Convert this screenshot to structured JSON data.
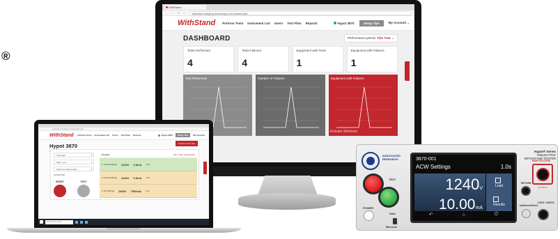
{
  "registered_mark": "®",
  "monitor": {
    "browser": {
      "tab_title": "WithStand",
      "nav_buttons": "← → C ⌂",
      "url": "withstand-staging.herokuapp.com/dashboard"
    },
    "app": {
      "logo_main": "WithStand",
      "logo_suffix": "",
      "menu": [
        "Perform Tests",
        "Instrument List",
        "Users",
        "Test Files",
        "Reports"
      ],
      "device_name": "Hypot 3870",
      "setup_button": "Setup Tips",
      "account": "My Account"
    },
    "dashboard": {
      "title": "DASHBOARD",
      "period_label": "Performance period:",
      "period_value": "This Year",
      "cards": [
        {
          "label": "Tests Performed",
          "value": "4"
        },
        {
          "label": "Tests Failures",
          "value": "4"
        },
        {
          "label": "Equipment with Tests",
          "value": "1"
        },
        {
          "label": "Equipment with Failures",
          "value": "1"
        }
      ],
      "charts": [
        {
          "title": "Test Performed"
        },
        {
          "title": "Number of Failures"
        },
        {
          "title": "Equipment with Failures"
        }
      ],
      "watermark": "Activate Windows"
    }
  },
  "laptop": {
    "url": "withstand-staging.herokuapp.com",
    "logo_main": "WithStand",
    "menu": [
      "Perform Tests",
      "Instrument List",
      "Users",
      "Test Files",
      "Reports"
    ],
    "device_name": "Hypot 3870",
    "setup_button": "Setup Tips",
    "account": "My Account",
    "title": "Hypot 3870",
    "subtitle": "Serial# 0002345 | Status: OUTPUT-ON",
    "red_button": "Perform Next Test",
    "selects": [
      "4 Product",
      "Step 1 of 1",
      "Select a serial number"
    ],
    "section_label": "ACCEPTED",
    "results": [
      {
        "label": "Product",
        "v1": "",
        "v2": "",
        "v3": "Fail - View Test Results"
      },
      {
        "label": "1. ACW Settings",
        "v1": "1240V",
        "v2": "0.5mA",
        "v3": "1.0s"
      },
      {
        "label": "2. ACW Settings",
        "v1": "1240V",
        "v2": "0.5mA",
        "v3": "1.0s"
      },
      {
        "label": "3. IR Settings",
        "v1": "1500V",
        "v2": "7500mA",
        "v3": "1.0s"
      }
    ],
    "buttons": {
      "reset": "RESET",
      "test": "TEST"
    },
    "search_placeholder": "Type here to search"
  },
  "device": {
    "brand": "ASSOCIATED RESEARCH",
    "series": "Hypot® Series",
    "series_sub": "DIELECTRIC WITHSTAND TESTER",
    "model": "3870-001",
    "mode": "ACW Settings",
    "time": "1.0s",
    "voltage": "1240",
    "voltage_unit": "V",
    "current": "10.00",
    "current_unit": "mA",
    "side_buttons": [
      "Load",
      "Results"
    ],
    "labels": {
      "test": "TEST",
      "power": "POWER",
      "data": "Data",
      "barcode": "Barcode",
      "hv": "HIGH VOLTAGE",
      "return": "RETURN",
      "caution": "CAUTION",
      "knob": "Up/Down/Select",
      "cont": "CONT. CHECK"
    }
  }
}
